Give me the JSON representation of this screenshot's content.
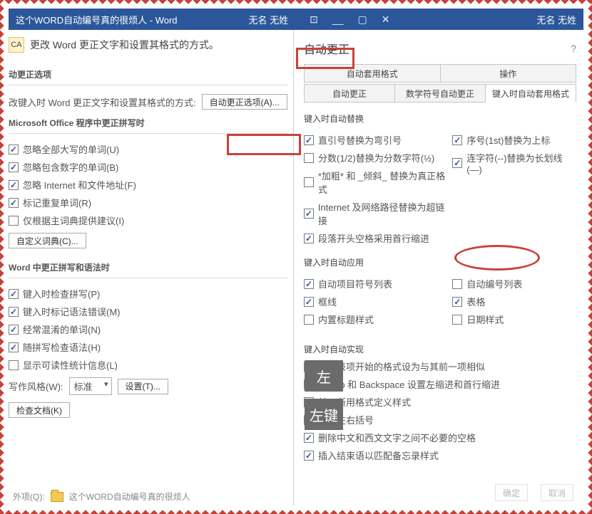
{
  "titlebar": {
    "doc_title": "这个WORD自动编号真的很烦人 - Word",
    "center_name": "无名 无姓",
    "right_user": "无名 无姓",
    "win_min": "__",
    "win_restore": "▢",
    "win_close": "✕",
    "box_icon": "⊡"
  },
  "left": {
    "intro_icon": "CA",
    "intro_text": "更改 Word 更正文字和设置其格式的方式。",
    "sec1": "动更正选项",
    "sec1_line": "改键入时 Word 更正文字和设置其格式的方式:",
    "autocorrect_btn": "自动更正选项(A)...",
    "sec2": "Microsoft Office 程序中更正拼写时",
    "cb1": "忽略全部大写的单词(U)",
    "cb2": "忽略包含数字的单词(B)",
    "cb3": "忽略 Internet 和文件地址(F)",
    "cb4": "标记重复单词(R)",
    "cb5": "仅根据主词典提供建议(I)",
    "dict_btn": "自定义词典(C)...",
    "sec3": "Word 中更正拼写和语法时",
    "cb6": "键入时检查拼写(P)",
    "cb7": "键入时标记语法错误(M)",
    "cb8": "经常混淆的单词(N)",
    "cb9": "随拼写检查语法(H)",
    "cb10": "显示可读性统计信息(L)",
    "style_label": "写作风格(W):",
    "style_val": "标准",
    "settings_btn": "设置(T)...",
    "recheck_btn": "检查文档(K)",
    "ext_label": "外项(Q):",
    "ext_doc": "这个WORD自动编号真的很烦人"
  },
  "right": {
    "dlg_title": "自动更正",
    "help": "?",
    "tab_r1_a": "自动套用格式",
    "tab_r1_b": "操作",
    "tab_r2_a": "自动更正",
    "tab_r2_b": "数学符号自动更正",
    "tab_r2_c": "键入时自动套用格式",
    "s1": "键入时自动替换",
    "c1a": "直引号替换为弯引号",
    "c1b": "序号(1st)替换为上标",
    "c2a": "分数(1/2)替换为分数字符(½)",
    "c2b": "连字符(--)替换为长划线(—)",
    "c3a": "*加粗* 和 _倾斜_ 替换为真正格式",
    "c4a": "Internet 及网络路径替换为超链接",
    "c5a": "段落开头空格采用首行缩进",
    "s2": "键入时自动应用",
    "d1a": "自动项目符号列表",
    "d1b": "自动编号列表",
    "d2a": "框线",
    "d2b": "表格",
    "d3a": "内置标题样式",
    "d3b": "日期样式",
    "s3": "键入时自动实现",
    "e1": "将列表项开始的格式设为与其前一项相似",
    "e2": "用 Tab 和 Backspace 设置左缩进和首行缩进",
    "e3": "基于所用格式定义样式",
    "e4": "匹配左右括号",
    "e5": "删除中文和西文文字之间不必要的空格",
    "e6": "插入结束语以匹配备忘录样式",
    "ok_btn": "确定",
    "cancel_btn": "取消"
  },
  "watermark": {
    "w1": "左",
    "w2": "左键"
  }
}
